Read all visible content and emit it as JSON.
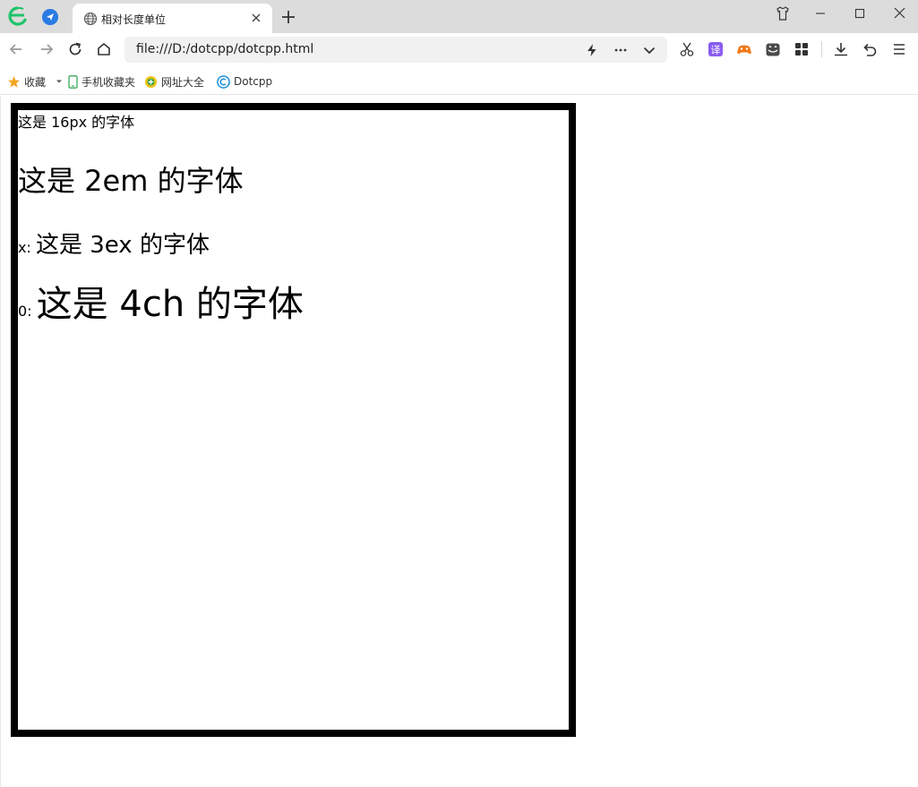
{
  "browser": {
    "tab_title": "相对长度单位",
    "url": "file:///D:/dotcpp/dotcpp.html"
  },
  "bookmarks": {
    "favorites": "收藏",
    "mobile_favorites": "手机收藏夹",
    "site_directory": "网址大全",
    "dotcpp": "Dotcpp"
  },
  "content": {
    "line1": "这是 16px 的字体",
    "line2": "这是 2em 的字体",
    "line3_prefix": "x:",
    "line3_text": "这是 3ex 的字体",
    "line4_prefix": "0:",
    "line4_text": "这是 4ch 的字体"
  },
  "colors": {
    "titlebar": "#dcdcdc",
    "tab_active": "#ffffff",
    "box_border": "#000000"
  },
  "icons": [
    "browser-logo-icon",
    "pinned-tab-icon",
    "globe-icon",
    "close-icon",
    "plus-icon",
    "skin-icon",
    "minimize-icon",
    "maximize-icon",
    "window-close-icon",
    "back-icon",
    "forward-icon",
    "refresh-icon",
    "home-icon",
    "lightning-icon",
    "more-icon",
    "chevron-down-icon",
    "scissors-icon",
    "translate-icon",
    "game-icon",
    "cat-icon",
    "apps-icon",
    "download-icon",
    "undo-icon",
    "menu-icon",
    "star-icon"
  ]
}
